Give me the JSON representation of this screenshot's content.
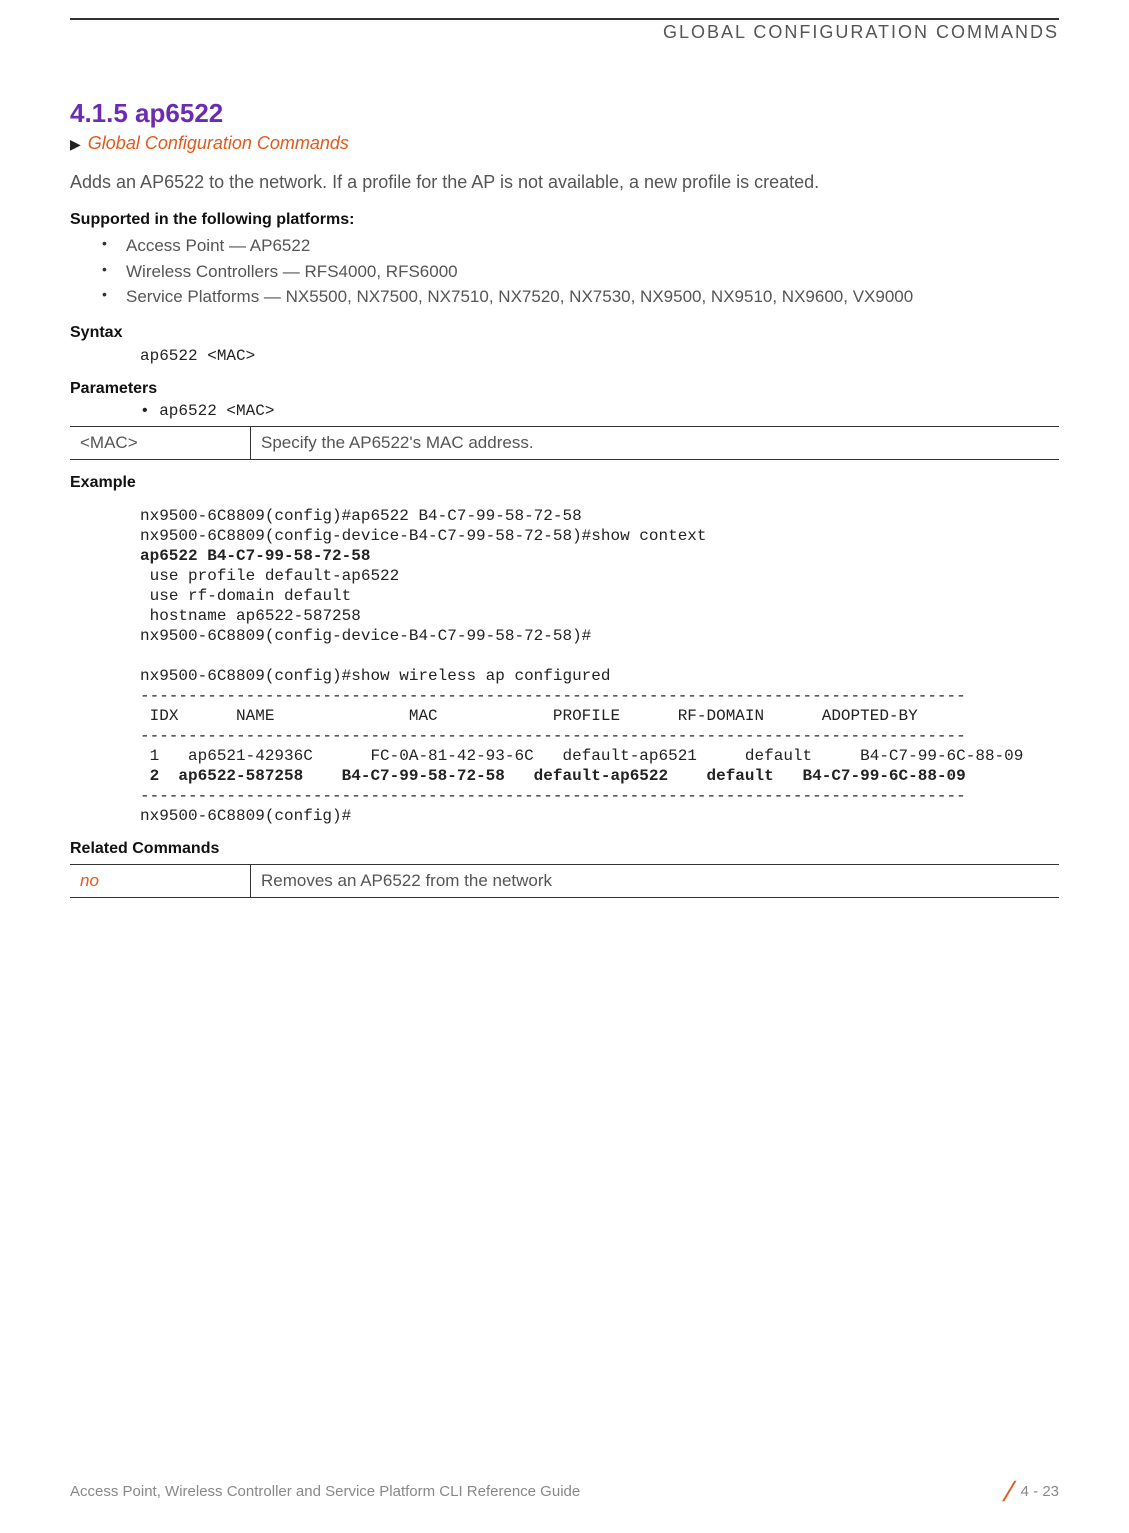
{
  "header": {
    "chapter": "GLOBAL CONFIGURATION COMMANDS"
  },
  "section": {
    "number_title": "4.1.5 ap6522",
    "link": "Global Configuration Commands",
    "intro": "Adds an AP6522 to the network. If a profile for the AP is not available, a new profile is created."
  },
  "supported": {
    "heading": "Supported in the following platforms:",
    "items": [
      "Access Point — AP6522",
      "Wireless Controllers — RFS4000, RFS6000",
      "Service Platforms — NX5500, NX7500, NX7510, NX7520, NX7530, NX9500, NX9510, NX9600, VX9000"
    ]
  },
  "syntax": {
    "heading": "Syntax",
    "code": "ap6522 <MAC>"
  },
  "parameters": {
    "heading": "Parameters",
    "bullet": "• ap6522 <MAC>",
    "table": {
      "key": "<MAC>",
      "desc": "Specify the AP6522's MAC address."
    }
  },
  "example": {
    "heading": "Example",
    "line1": "nx9500-6C8809(config)#ap6522 B4-C7-99-58-72-58",
    "line2": "nx9500-6C8809(config-device-B4-C7-99-58-72-58)#show context",
    "line3": "ap6522 B4-C7-99-58-72-58",
    "line4": " use profile default-ap6522",
    "line5": " use rf-domain default",
    "line6": " hostname ap6522-587258",
    "line7": "nx9500-6C8809(config-device-B4-C7-99-58-72-58)#",
    "line8": "",
    "line9": "nx9500-6C8809(config)#show wireless ap configured",
    "sep1": "--------------------------------------------------------------------------------------",
    "header_row": " IDX      NAME              MAC            PROFILE      RF-DOMAIN      ADOPTED-BY",
    "sep2": "--------------------------------------------------------------------------------------",
    "row1": " 1   ap6521-42936C      FC-0A-81-42-93-6C   default-ap6521     default     B4-C7-99-6C-88-09",
    "row2": " 2  ap6522-587258    B4-C7-99-58-72-58   default-ap6522    default   B4-C7-99-6C-88-09",
    "sep3": "--------------------------------------------------------------------------------------",
    "last": "nx9500-6C8809(config)#"
  },
  "related": {
    "heading": "Related Commands",
    "cmd": "no",
    "desc": "Removes an AP6522 from the network"
  },
  "footer": {
    "guide": "Access Point, Wireless Controller and Service Platform CLI Reference Guide",
    "page": "4 - 23"
  }
}
